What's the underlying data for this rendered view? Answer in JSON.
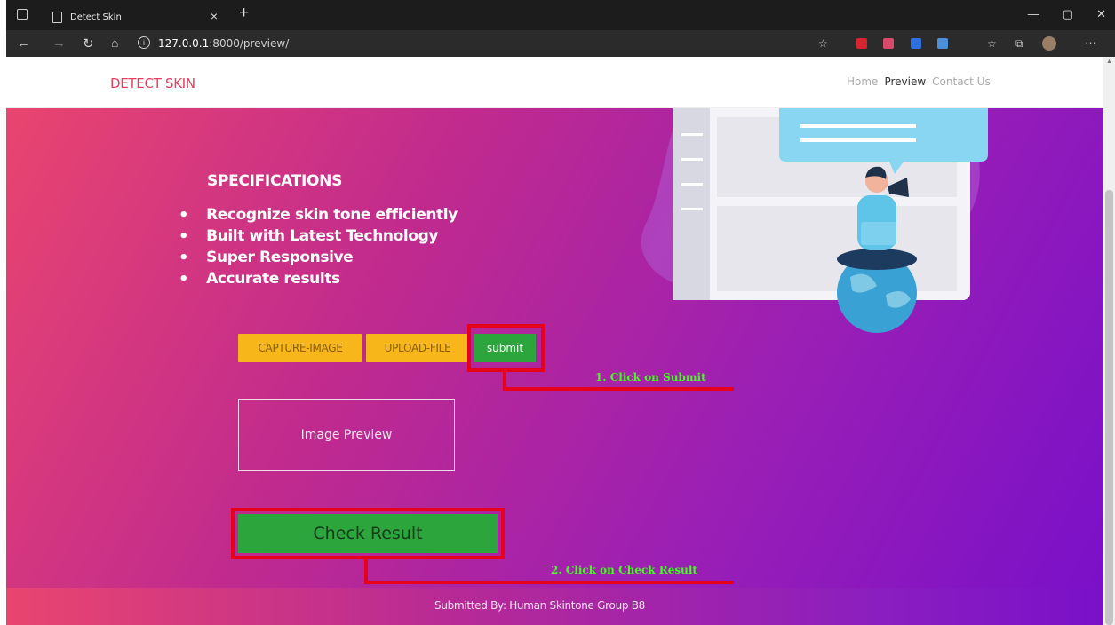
{
  "browser": {
    "tab_title": "Detect Skin",
    "url_host": "127.0.0.1",
    "url_rest": ":8000/preview/"
  },
  "site": {
    "brand": "DETECT SKIN",
    "nav": [
      "Home",
      "Preview",
      "Contact Us"
    ],
    "active_nav": "Preview"
  },
  "specs": {
    "title": "SPECIFICATIONS",
    "items": [
      "Recognize skin tone efficiently",
      "Built with Latest Technology",
      "Super Responsive",
      "Accurate results"
    ]
  },
  "buttons": {
    "capture": "CAPTURE-IMAGE",
    "upload": "UPLOAD-FILE",
    "submit": "submit",
    "check_result": "Check Result"
  },
  "preview_label": "Image Preview",
  "annotations": {
    "step1": "1. Click on Submit",
    "step2": "2. Click on Check Result"
  },
  "footer": "Submitted By: Human Skintone Group B8",
  "colors": {
    "brand": "#e93c5e",
    "button_yellow": "#f7b71b",
    "button_green": "#2ba53c",
    "annotation_red": "#e6001b",
    "annotation_text": "#40ff1a"
  }
}
